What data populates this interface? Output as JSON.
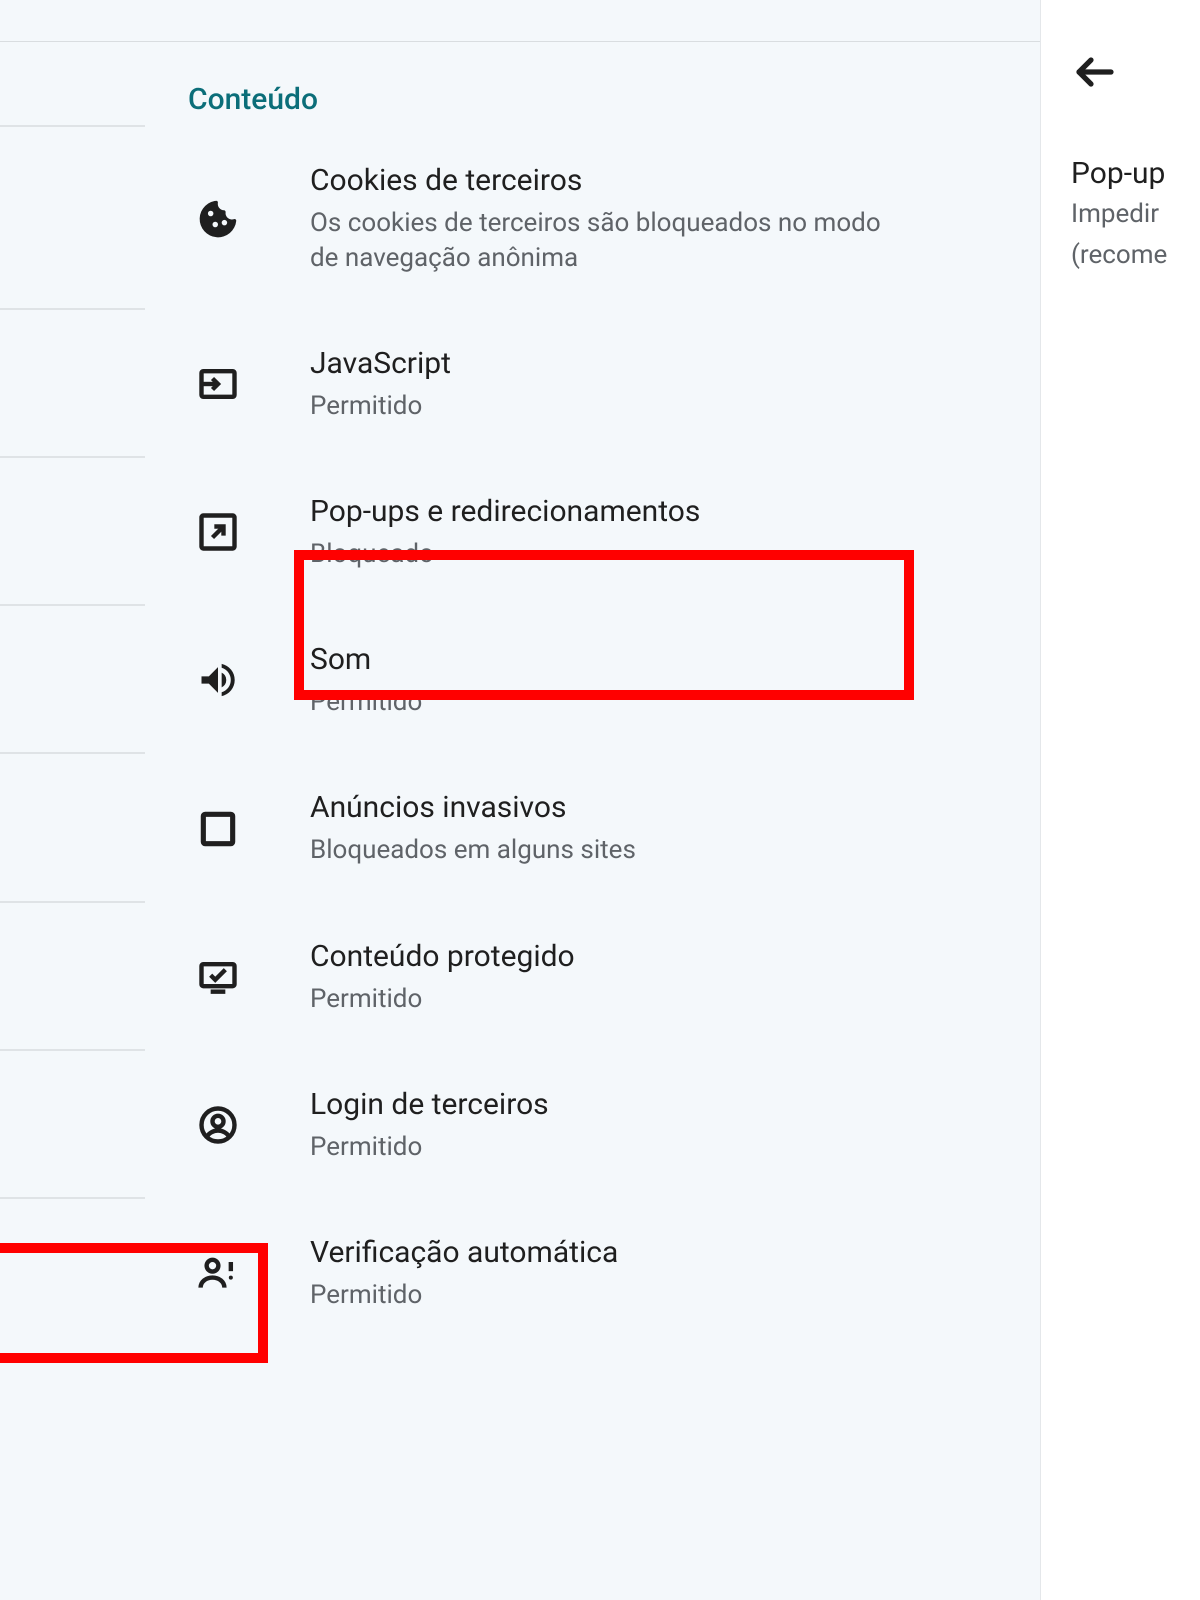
{
  "header": {
    "section": "Conteúdo"
  },
  "rows": {
    "cookies": {
      "title": "Cookies de terceiros",
      "sub": "Os cookies de terceiros são bloqueados no modo de navegação anônima"
    },
    "javascript": {
      "title": "JavaScript",
      "sub": "Permitido"
    },
    "popups": {
      "title": "Pop-ups e redirecionamentos",
      "sub": "Bloqueado"
    },
    "sound": {
      "title": "Som",
      "sub": "Permitido"
    },
    "ads": {
      "title": "Anúncios invasivos",
      "sub": "Bloqueados em alguns sites"
    },
    "protected": {
      "title": "Conteúdo protegido",
      "sub": "Permitido"
    },
    "thirdparty": {
      "title": "Login de terceiros",
      "sub": "Permitido"
    },
    "autoverify": {
      "title": "Verificação automática",
      "sub": "Permitido"
    }
  },
  "rightPanel": {
    "title": "Pop-up",
    "sub1": "Impedir",
    "sub2": "(recome"
  }
}
